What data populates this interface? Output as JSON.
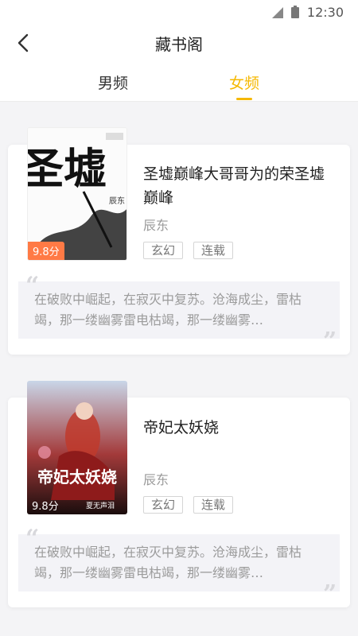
{
  "status": {
    "time": "12:30"
  },
  "header": {
    "title": "藏书阁"
  },
  "tabs": [
    {
      "label": "男频"
    },
    {
      "label": "女频"
    }
  ],
  "books": [
    {
      "title": "圣墟巅峰大哥哥为的荣圣墟巅峰",
      "author": "辰东",
      "tags": [
        "玄幻",
        "连载"
      ],
      "rating": "9.8分",
      "cover_text": "圣墟",
      "cover_sub": "辰东",
      "description": "在破败中崛起，在寂灭中复苏。沧海成尘，雷枯竭，那一缕幽雾雷电枯竭，那一缕幽雾…"
    },
    {
      "title": "帝妃太妖娆",
      "author": "辰东",
      "tags": [
        "玄幻",
        "连载"
      ],
      "rating": "9.8分",
      "cover_text": "帝妃太妖娆",
      "cover_sub": "夏无声泪",
      "description": "在破败中崛起，在寂灭中复苏。沧海成尘，雷枯竭，那一缕幽雾雷电枯竭，那一缕幽雾…"
    }
  ]
}
